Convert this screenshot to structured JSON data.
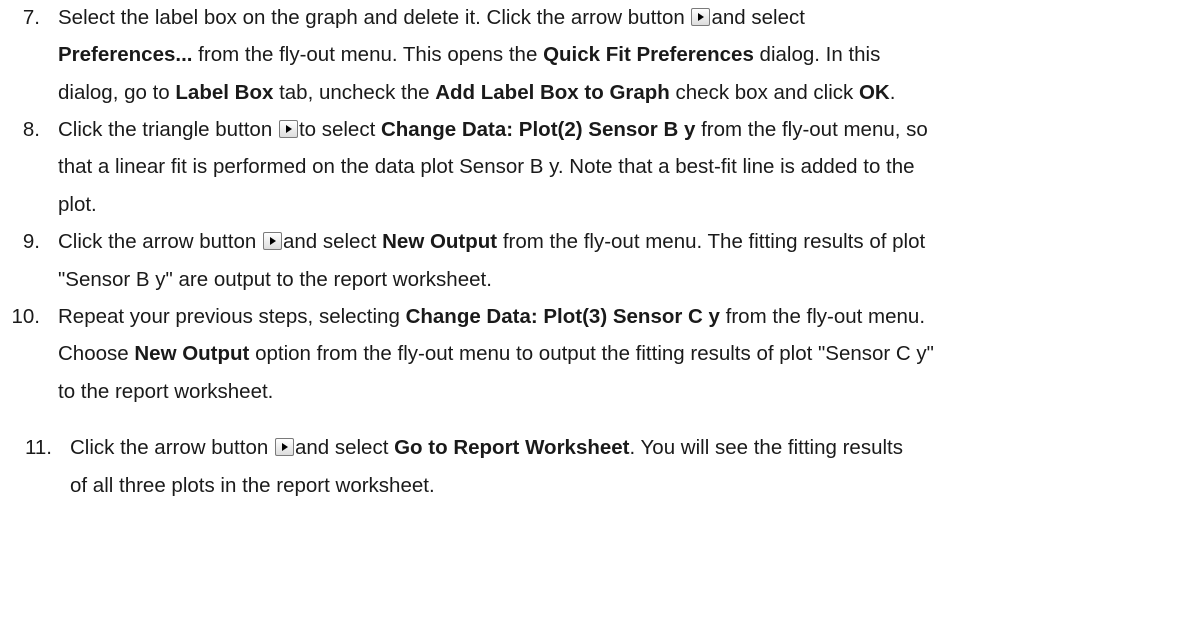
{
  "steps": [
    {
      "num": "7.",
      "lines": [
        [
          {
            "t": "Select the label box on the graph and delete it. Click the arrow button "
          },
          {
            "icon": "arrow-button-icon"
          },
          {
            "t": "and select"
          }
        ],
        [
          {
            "t": "Preferences...",
            "b": true
          },
          {
            "t": " from the fly-out menu. This opens the "
          },
          {
            "t": "Quick Fit Preferences",
            "b": true
          },
          {
            "t": " dialog. In this"
          }
        ],
        [
          {
            "t": "dialog, go to "
          },
          {
            "t": "Label Box",
            "b": true
          },
          {
            "t": " tab, uncheck the "
          },
          {
            "t": "Add Label Box to Graph",
            "b": true
          },
          {
            "t": " check box and click "
          },
          {
            "t": "OK",
            "b": true
          },
          {
            "t": "."
          }
        ]
      ]
    },
    {
      "num": "8.",
      "lines": [
        [
          {
            "t": "Click the triangle button "
          },
          {
            "icon": "triangle-button-icon"
          },
          {
            "t": "to select "
          },
          {
            "t": "Change Data: Plot(2) Sensor B y",
            "b": true
          },
          {
            "t": " from the fly-out menu, so"
          }
        ],
        [
          {
            "t": "that a linear fit is performed on the data plot Sensor B y. Note that a best-fit line is added to the"
          }
        ],
        [
          {
            "t": "plot."
          }
        ]
      ]
    },
    {
      "num": "9.",
      "lines": [
        [
          {
            "t": "Click the arrow button "
          },
          {
            "icon": "arrow-button-icon"
          },
          {
            "t": "and select "
          },
          {
            "t": "New Output",
            "b": true
          },
          {
            "t": " from the fly-out menu. The fitting results of plot"
          }
        ],
        [
          {
            "t": "\"Sensor B y\" are output to the report worksheet."
          }
        ]
      ]
    },
    {
      "num": "10.",
      "lines": [
        [
          {
            "t": "Repeat your previous steps, selecting "
          },
          {
            "t": "Change Data: Plot(3) Sensor C y",
            "b": true
          },
          {
            "t": " from the fly-out menu."
          }
        ],
        [
          {
            "t": "Choose "
          },
          {
            "t": "New Output",
            "b": true
          },
          {
            "t": " option from the fly-out menu to output the fitting results of plot \"Sensor C y\""
          }
        ],
        [
          {
            "t": "to the report worksheet."
          }
        ]
      ]
    },
    {
      "num": "11.",
      "lines": [
        [
          {
            "t": "Click the arrow button "
          },
          {
            "icon": "arrow-button-icon"
          },
          {
            "t": "and select "
          },
          {
            "t": "Go to Report Worksheet",
            "b": true
          },
          {
            "t": ". You will see the fitting results"
          }
        ],
        [
          {
            "t": "of all three plots in the report worksheet."
          }
        ]
      ]
    }
  ]
}
